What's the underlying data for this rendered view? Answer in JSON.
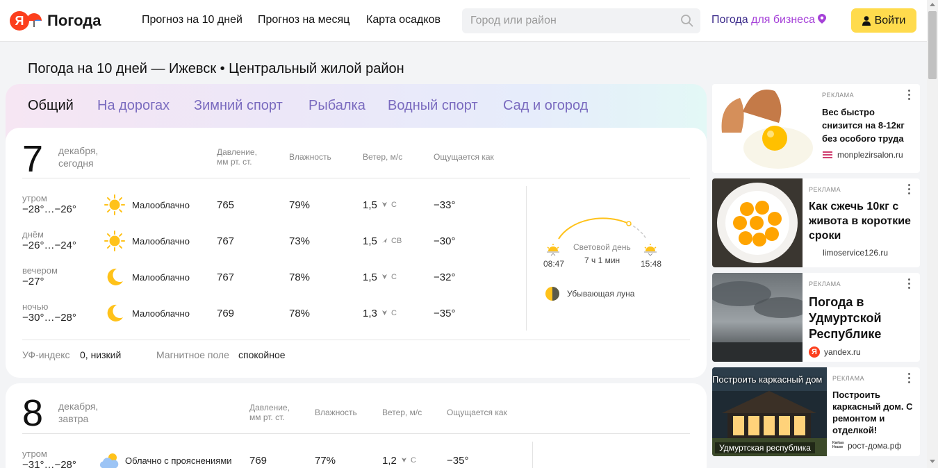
{
  "header": {
    "logo_letter": "Я",
    "logo_text": "Погода",
    "nav": [
      "Прогноз на 10 дней",
      "Прогноз на месяц",
      "Карта осадков"
    ],
    "search_placeholder": "Город или район",
    "business_a": "Погода ",
    "business_b": "для бизнеса",
    "login_label": "Войти"
  },
  "page_title": "Погода на 10 дней — Ижевск • Центральный жилой район",
  "tabs": [
    "Общий",
    "На дорогах",
    "Зимний спорт",
    "Рыбалка",
    "Водный спорт",
    "Сад и огород"
  ],
  "columns": {
    "pressure": [
      "Давление,",
      "мм рт. ст."
    ],
    "humidity": "Влажность",
    "wind": "Ветер, м/с",
    "feels": "Ощущается как"
  },
  "day1": {
    "num": "7",
    "sub": [
      "декабря,",
      "сегодня"
    ],
    "rows": [
      {
        "part": "утром",
        "temp": "−28°…−26°",
        "icon": "sun-icon",
        "cond": "Малооблачно",
        "pressure": "765",
        "humidity": "79%",
        "wind": "1,5",
        "dir": "С",
        "feels": "−33°"
      },
      {
        "part": "днём",
        "temp": "−26°…−24°",
        "icon": "sun-icon",
        "cond": "Малооблачно",
        "pressure": "767",
        "humidity": "73%",
        "wind": "1,5",
        "dir": "СВ",
        "feels": "−30°"
      },
      {
        "part": "вечером",
        "temp": "−27°",
        "icon": "moon-icon",
        "cond": "Малооблачно",
        "pressure": "767",
        "humidity": "78%",
        "wind": "1,5",
        "dir": "С",
        "feels": "−32°"
      },
      {
        "part": "ночью",
        "temp": "−30°…−28°",
        "icon": "moon-icon",
        "cond": "Малооблачно",
        "pressure": "769",
        "humidity": "78%",
        "wind": "1,3",
        "dir": "С",
        "feels": "−35°"
      }
    ],
    "daylight_label": "Световой день",
    "daylight_value": "7 ч 1 мин",
    "sunrise": "08:47",
    "sunset": "15:48",
    "moon": "Убывающая луна",
    "uv_label": "УФ-индекс",
    "uv_value": "0, низкий",
    "mag_label": "Магнитное поле",
    "mag_value": "спокойное"
  },
  "day2": {
    "num": "8",
    "sub": [
      "декабря,",
      "завтра"
    ],
    "row": {
      "part": "утром",
      "temp": "−31°…−28°",
      "icon": "cloud-sun-icon",
      "cond": "Облачно с прояснениями",
      "pressure": "769",
      "humidity": "77%",
      "wind": "1,2",
      "dir": "С",
      "feels": "−35°"
    }
  },
  "ads": [
    {
      "label": "РЕКЛАМА",
      "title": "Вес быстро снизится на 8-12кг без особого труда",
      "source": "monplezirsalon.ru"
    },
    {
      "label": "РЕКЛАМА",
      "title": "Как сжечь 10кг с живота в короткие сроки",
      "source": "limoservice126.ru"
    },
    {
      "label": "РЕКЛАМА",
      "title": "Погода в Удмуртской Республике",
      "source": "yandex.ru"
    },
    {
      "label": "РЕКЛАМА",
      "title": "Построить каркасный дом. С ремонтом и отделкой!",
      "source": "рост-дома.рф",
      "img_top": "Построить каркасный дом",
      "img_bottom": "Удмуртская республика",
      "logo_text": "Karkas House"
    }
  ],
  "colors": {
    "accent_yellow": "#ffdb4d",
    "tab_color": "#7a6bbf",
    "brand_red": "#fc3f1d"
  }
}
